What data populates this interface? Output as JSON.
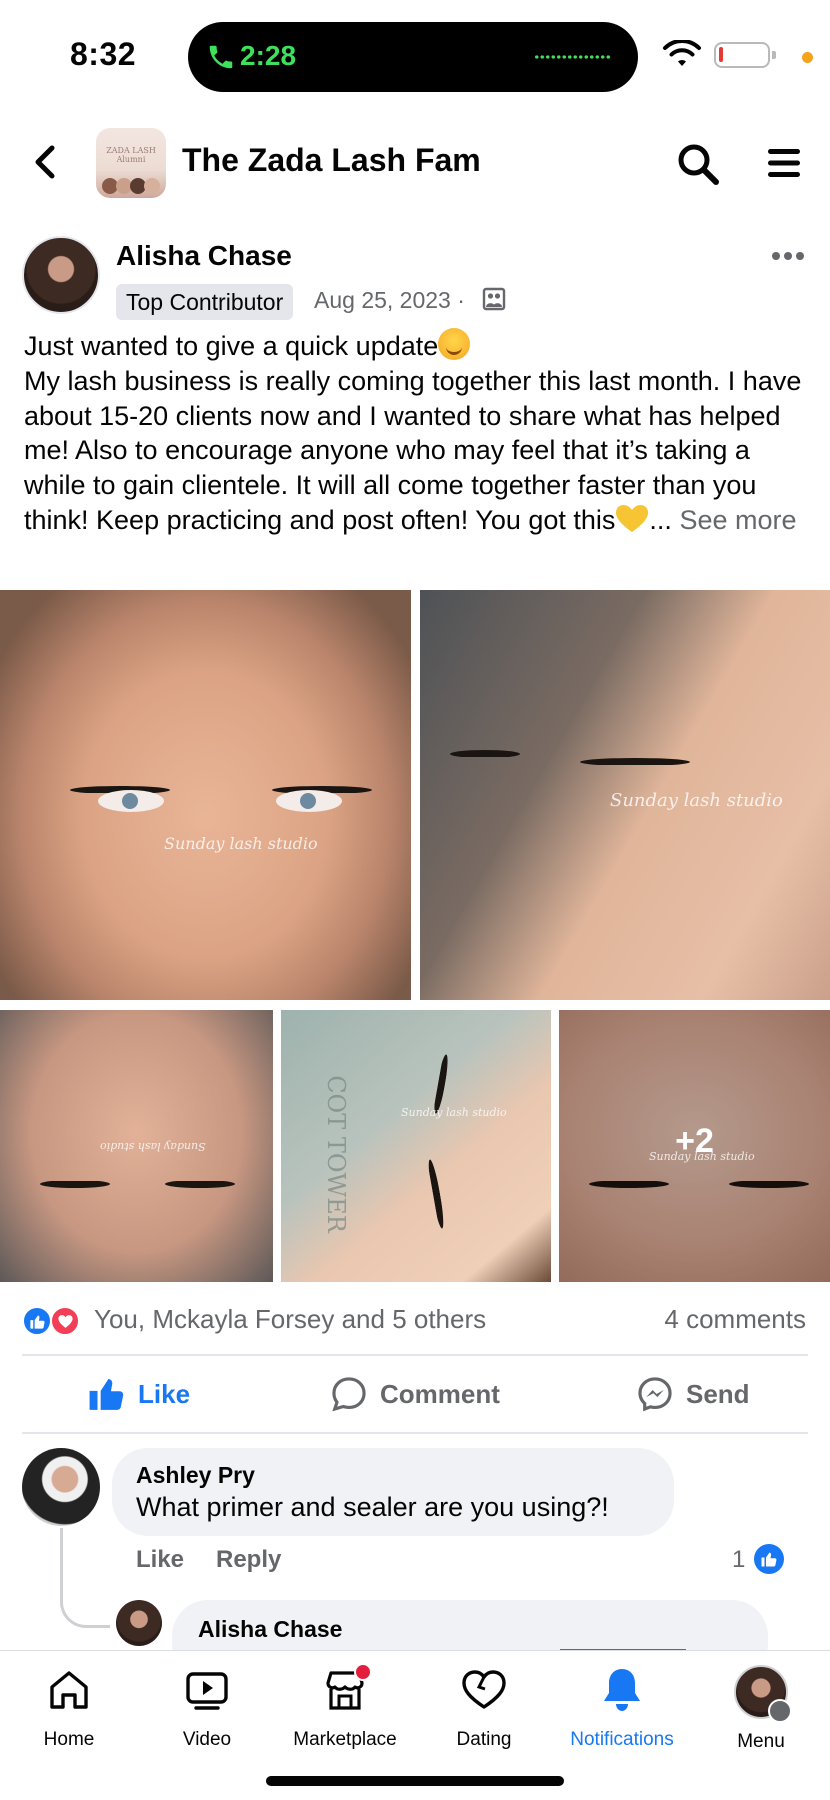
{
  "status_bar": {
    "time": "8:32",
    "call_duration": "2:28"
  },
  "header": {
    "group_name": "The Zada Lash Fam",
    "group_avatar_text": "ZADA LASH Alumni"
  },
  "post": {
    "author": "Alisha Chase",
    "badge": "Top Contributor",
    "date": "Aug 25, 2023 ·",
    "text_line1": "Just wanted to give a quick update",
    "text_body": "My lash business is really coming together this last month. I have about 15-20 clients now and I wanted to share what has helped me! Also to encourage anyone who may feel that it’s taking a while to gain clientele. It will all come together faster than you think! Keep practicing and post often! You got this",
    "ellipsis": "...",
    "see_more": "See more",
    "photos": {
      "watermark": "Sunday lash studio",
      "extra_count": "+2",
      "background_text": "COT TOWER"
    },
    "reactions_text": "You, Mckayla Forsey and 5 others",
    "comments_count": "4 comments"
  },
  "actions": {
    "like": "Like",
    "comment": "Comment",
    "send": "Send"
  },
  "comments": [
    {
      "author": "Ashley Pry",
      "text": "What primer and sealer are you using?!",
      "like_label": "Like",
      "reply_label": "Reply",
      "reaction_count": "1"
    }
  ],
  "reply": {
    "author": "Alisha Chase"
  },
  "bottom_nav": [
    {
      "label": "Home",
      "icon": "home-icon"
    },
    {
      "label": "Video",
      "icon": "video-icon"
    },
    {
      "label": "Marketplace",
      "icon": "marketplace-icon"
    },
    {
      "label": "Dating",
      "icon": "dating-icon"
    },
    {
      "label": "Notifications",
      "icon": "bell-icon",
      "active": true
    },
    {
      "label": "Menu",
      "icon": "profile-avatar"
    }
  ],
  "colors": {
    "accent": "#1877f2",
    "secondary_text": "#65676b",
    "love": "#f33e58",
    "call_green": "#3ee05c"
  }
}
